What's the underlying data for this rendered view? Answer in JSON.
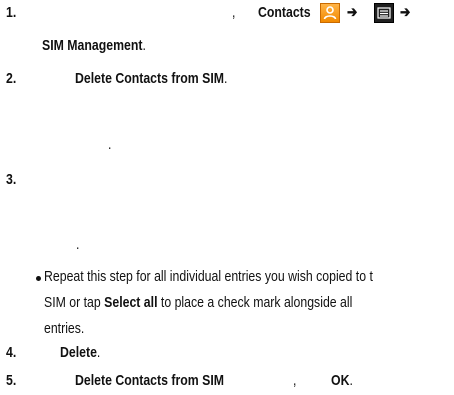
{
  "steps": {
    "s1": {
      "num": "1.",
      "comma": ",",
      "contacts": "Contacts",
      "arrow1": "➔",
      "arrow2": "➔",
      "sim_mgmt": "SIM Management",
      "period": "."
    },
    "s2": {
      "num": "2.",
      "delete_from_sim": "Delete Contacts from SIM",
      "period": ".",
      "dot_line": "."
    },
    "s3": {
      "num": "3.",
      "dot_line": ".",
      "bullet_line1": "Repeat this step for all individual entries you wish copied to t",
      "bullet_line2_a": "SIM or tap ",
      "select_all": "Select all",
      "bullet_line2_b": " to place a check mark alongside all",
      "bullet_line3": "entries."
    },
    "s4": {
      "num": "4.",
      "delete": "Delete",
      "period": "."
    },
    "s5": {
      "num": "5.",
      "delete_from_sim": "Delete Contacts from SIM",
      "comma": ",",
      "ok": "OK",
      "period": "."
    }
  },
  "icons": {
    "contacts": "contacts-app-icon",
    "menu": "menu-key-icon"
  },
  "colors": {
    "contacts_icon": "#f28a00",
    "menu_icon": "#1f1f1f"
  }
}
